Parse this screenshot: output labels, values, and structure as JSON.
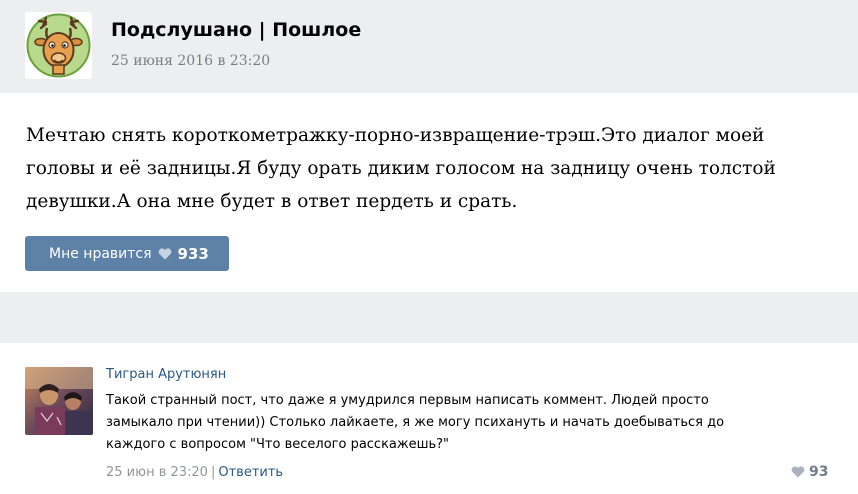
{
  "post": {
    "group_name": "Подслушано | Пошлое",
    "date": "25 июня 2016 в 23:20",
    "text": "Мечтаю снять короткометражку-порно-извращение-трэш.Это диалог моей головы и её задницы.Я буду орать диким голосом на задницу очень толстой девушки.А она мне будет в ответ пердеть и срать.",
    "like_label": "Мне нравится",
    "like_count": "933",
    "icons": {
      "group_avatar": "deer-avatar-icon",
      "like": "heart-icon"
    },
    "colors": {
      "like_button": "#5e81a8",
      "link": "#2a5885"
    }
  },
  "comment": {
    "author": "Тигран Арутюнян",
    "text": "Такой странный пост, что даже я умудрился первым написать коммент. Людей просто замыкало при чтении)) Столько лайкаете, я же могу психануть и начать доебываться до каждого с вопросом \"Что веселого расскажешь?\"",
    "date": "25 июн в 23:20",
    "separator": "|",
    "reply_label": "Ответить",
    "like_count": "93",
    "icons": {
      "avatar": "user-photo-avatar",
      "like": "heart-icon"
    }
  }
}
